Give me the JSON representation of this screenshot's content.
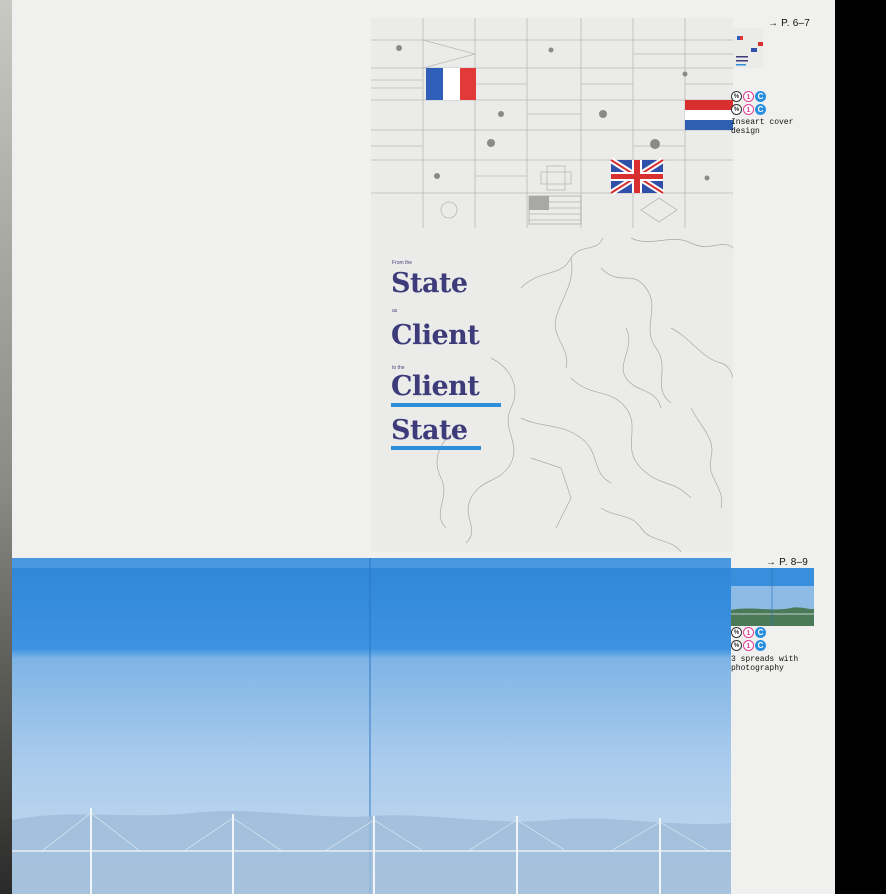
{
  "cover": {
    "lines": [
      {
        "kind": "small",
        "text": "From the"
      },
      {
        "kind": "big",
        "text": "State"
      },
      {
        "kind": "small",
        "text": "as"
      },
      {
        "kind": "big",
        "text": "Client"
      },
      {
        "kind": "small",
        "text": "to the"
      },
      {
        "kind": "big",
        "text": "Client"
      },
      {
        "kind": "big",
        "text": "State"
      }
    ],
    "underline_color": "#2f8ed8",
    "title_color": "#3d3b7a"
  },
  "annotations": [
    {
      "page_ref": "→ P. 6–7",
      "marks": [
        "pantone",
        "1",
        "C"
      ],
      "note": "Inseart cover design"
    },
    {
      "page_ref": "→ P. 8–9",
      "marks": [
        "pantone",
        "1",
        "C"
      ],
      "note": "3 spreads with photography"
    }
  ],
  "colors": {
    "page": "#f0f0ee",
    "sky": "#2f86d8",
    "ink": "#3d3b7a",
    "cyan": "#2a8ee0",
    "magenta": "#e13d95"
  }
}
